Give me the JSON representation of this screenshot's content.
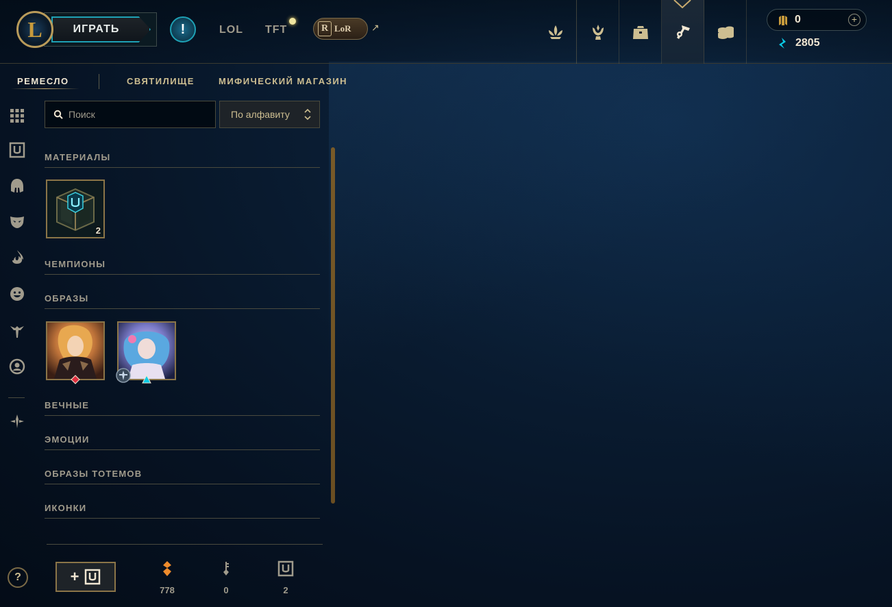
{
  "header": {
    "logo_letter": "L",
    "play_label": "ИГРАТЬ",
    "alert_symbol": "!",
    "tabs": [
      {
        "label": "LOL"
      },
      {
        "label": "TFT"
      }
    ],
    "lor_label": "LoR",
    "lor_letter": "R",
    "external_arrow": "↗",
    "nav_icons": [
      "lotus-icon",
      "trophy-icon",
      "backpack-icon",
      "hextech-hammer-icon",
      "coins-store-icon"
    ],
    "active_nav_icon": "hextech-hammer-icon",
    "rp_value": "0",
    "rp_plus": "+",
    "be_value": "2805"
  },
  "subtabs": [
    {
      "label": "РЕМЕСЛО",
      "active": true
    },
    {
      "label": "СВЯТИЛИЩЕ",
      "active": false
    },
    {
      "label": "МИФИЧЕСКИЙ МАГАЗИН",
      "active": false
    }
  ],
  "sidebar": {
    "icons": [
      "grid-icon",
      "chest-icon",
      "helmet-icon",
      "mask-icon",
      "flame-icon",
      "emote-face-icon",
      "ward-icon",
      "profile-icon",
      "arrows-icon"
    ],
    "help_symbol": "?"
  },
  "search": {
    "placeholder": "Поиск",
    "value": ""
  },
  "sort": {
    "selected": "По алфавиту"
  },
  "sections": [
    {
      "title": "МАТЕРИАЛЫ"
    },
    {
      "title": "ЧЕМПИОНЫ"
    },
    {
      "title": "ОБРАЗЫ"
    },
    {
      "title": "ВЕЧНЫЕ"
    },
    {
      "title": "ЭМОЦИИ"
    },
    {
      "title": "ОБРАЗЫ ТОТЕМОВ"
    },
    {
      "title": "ИКОНКИ"
    }
  ],
  "materials": [
    {
      "name": "hextech-chest",
      "count": "2"
    }
  ],
  "skins": [
    {
      "name": "skin-tile-1",
      "gem": "red-gem-icon"
    },
    {
      "name": "skin-tile-2",
      "gem": "blue-gem-icon",
      "badge": "arcane-badge-icon"
    }
  ],
  "footer": {
    "add_plus": "+",
    "orange_essence": "778",
    "keys": "0",
    "chests": "2"
  },
  "colors": {
    "gold": "#c8aa6e",
    "teal": "#1ea1b5",
    "text_light": "#f0e6d2",
    "text_muted": "#a09b8c",
    "orange_essence": "#f08c2c",
    "blue_essence": "#0acbe6"
  }
}
